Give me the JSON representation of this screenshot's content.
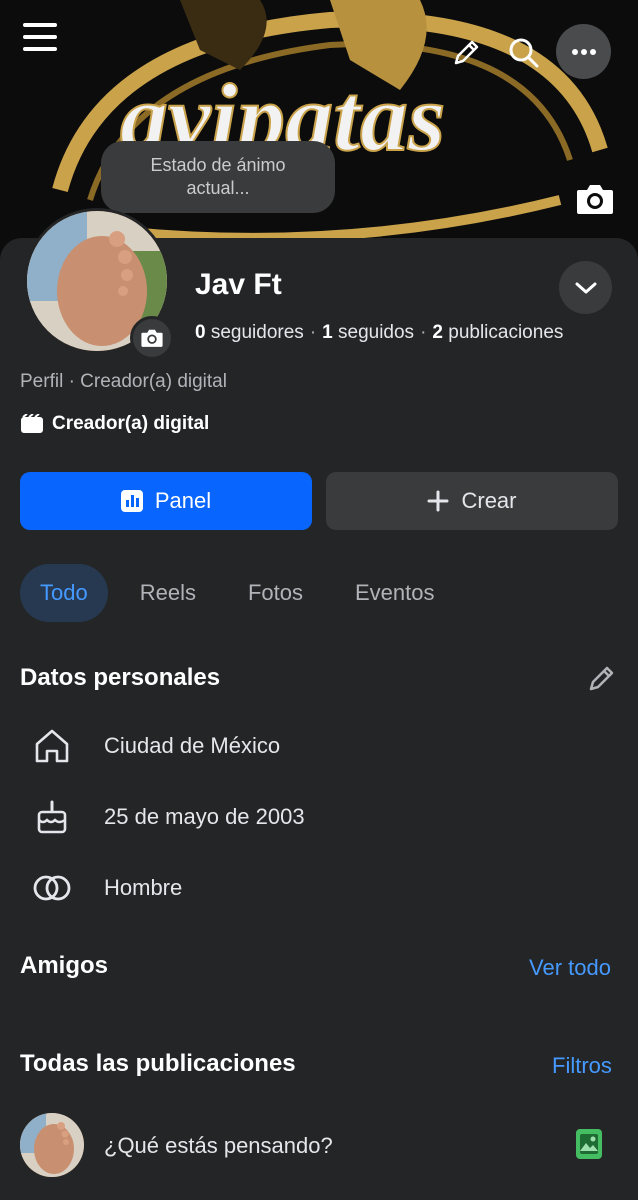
{
  "cover": {
    "logo_text": "avipatas",
    "mood_placeholder": "Estado de ánimo actual..."
  },
  "topbar": {
    "menu_icon": "hamburger-menu-icon",
    "edit_icon": "pencil-icon",
    "search_icon": "search-icon",
    "more_icon": "more-horizontal-icon"
  },
  "profile": {
    "name": "Jav Ft",
    "followers_count": "0",
    "followers_label": "seguidores",
    "following_count": "1",
    "following_label": "seguidos",
    "posts_count": "2",
    "posts_label": "publicaciones",
    "separator": "·",
    "subtitle": "Perfil · Creador(a) digital",
    "category": "Creador(a) digital"
  },
  "actions": {
    "panel_label": "Panel",
    "create_label": "Crear"
  },
  "tabs": [
    {
      "label": "Todo",
      "active": true
    },
    {
      "label": "Reels",
      "active": false
    },
    {
      "label": "Fotos",
      "active": false
    },
    {
      "label": "Eventos",
      "active": false
    }
  ],
  "personal": {
    "title": "Datos personales",
    "items": [
      {
        "icon": "home-icon",
        "text": "Ciudad de México"
      },
      {
        "icon": "birthday-cake-icon",
        "text": "25 de mayo de 2003"
      },
      {
        "icon": "gender-rings-icon",
        "text": "Hombre"
      }
    ]
  },
  "friends": {
    "title": "Amigos",
    "see_all": "Ver todo"
  },
  "posts": {
    "title": "Todas las publicaciones",
    "filters": "Filtros",
    "composer_placeholder": "¿Qué estás pensando?"
  },
  "colors": {
    "background": "#242526",
    "primary_blue": "#0866ff",
    "link_blue": "#4599ff",
    "surface": "#3a3b3c",
    "photo_green": "#45bd62",
    "cover_gold": "#c9a24a"
  }
}
